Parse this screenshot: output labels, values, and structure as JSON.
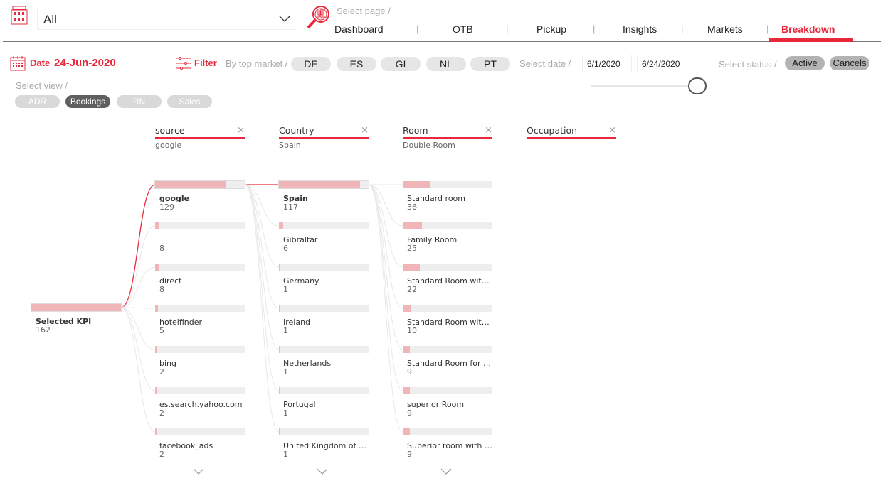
{
  "header": {
    "property_select": "All",
    "select_page_label": "Select page /",
    "nav": [
      {
        "label": "Dashboard"
      },
      {
        "label": "OTB"
      },
      {
        "label": "Pickup"
      },
      {
        "label": "Insights"
      },
      {
        "label": "Markets"
      },
      {
        "label": "Breakdown",
        "active": true
      }
    ],
    "nav_separator": "|"
  },
  "filters": {
    "date_label": "Date",
    "date_value": "24-Jun-2020",
    "filter_label": "Filter",
    "top_market_label": "By top market /",
    "markets": [
      "DE",
      "ES",
      "GI",
      "NL",
      "PT"
    ],
    "select_date_label": "Select date /",
    "date_from": "6/1/2020",
    "date_to": "6/24/2020",
    "select_status_label": "Select status /",
    "statuses": [
      "Active",
      "Cancels"
    ],
    "select_view_label": "Select view /",
    "views": [
      "ADR",
      "Bookings",
      "RN",
      "Sales"
    ],
    "active_view": "Bookings",
    "slider_value": 1.0
  },
  "colors": {
    "accent": "#e8293b",
    "bar_fill": "#efb5b9",
    "bar_track": "#eeeeee"
  },
  "tree": {
    "root": {
      "label": "Selected KPI",
      "value": "162"
    },
    "columns": [
      {
        "title": "source",
        "selected": "google",
        "nodes": [
          {
            "label": "google",
            "value": "129"
          },
          {
            "label": "",
            "value": "8"
          },
          {
            "label": "direct",
            "value": "8"
          },
          {
            "label": "hotelfinder",
            "value": "5"
          },
          {
            "label": "bing",
            "value": "2"
          },
          {
            "label": "es.search.yahoo.com",
            "value": "2"
          },
          {
            "label": "facebook_ads",
            "value": "2"
          }
        ]
      },
      {
        "title": "Country",
        "selected": "Spain",
        "nodes": [
          {
            "label": "Spain",
            "value": "117"
          },
          {
            "label": "Gibraltar",
            "value": "6"
          },
          {
            "label": "Germany",
            "value": "1"
          },
          {
            "label": "Ireland",
            "value": "1"
          },
          {
            "label": "Netherlands",
            "value": "1"
          },
          {
            "label": "Portugal",
            "value": "1"
          },
          {
            "label": "United Kingdom of Great Britain and Northern Ireland",
            "value": "1"
          }
        ]
      },
      {
        "title": "Room",
        "selected": "Double Room",
        "nodes": [
          {
            "label": "Standard room",
            "value": "36"
          },
          {
            "label": "Family Room",
            "value": "25"
          },
          {
            "label": "Standard Room with large bed",
            "value": "22"
          },
          {
            "label": "Standard Room with Garden view",
            "value": "10"
          },
          {
            "label": "Standard Room for single use",
            "value": "9"
          },
          {
            "label": "superior Room",
            "value": "9"
          },
          {
            "label": "Superior room with lateral sea view",
            "value": "9"
          }
        ]
      },
      {
        "title": "Occupation",
        "selected": "",
        "nodes": []
      }
    ],
    "close_glyph": "×"
  }
}
